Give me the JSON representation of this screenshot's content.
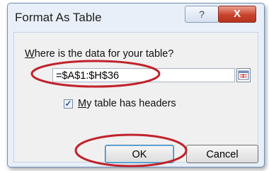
{
  "dialog": {
    "title": "Format As Table",
    "help_glyph": "?",
    "close_glyph": "X"
  },
  "prompt": {
    "label_first": "W",
    "label_rest": "here is the data for your table?"
  },
  "range_input": {
    "value": "=$A$1:$H$36"
  },
  "headers_checkbox": {
    "checked": true,
    "label_first": "M",
    "label_rest": "y table has headers"
  },
  "buttons": {
    "ok": "OK",
    "cancel": "Cancel"
  },
  "annotations": {
    "highlight_color": "#c0232b"
  }
}
